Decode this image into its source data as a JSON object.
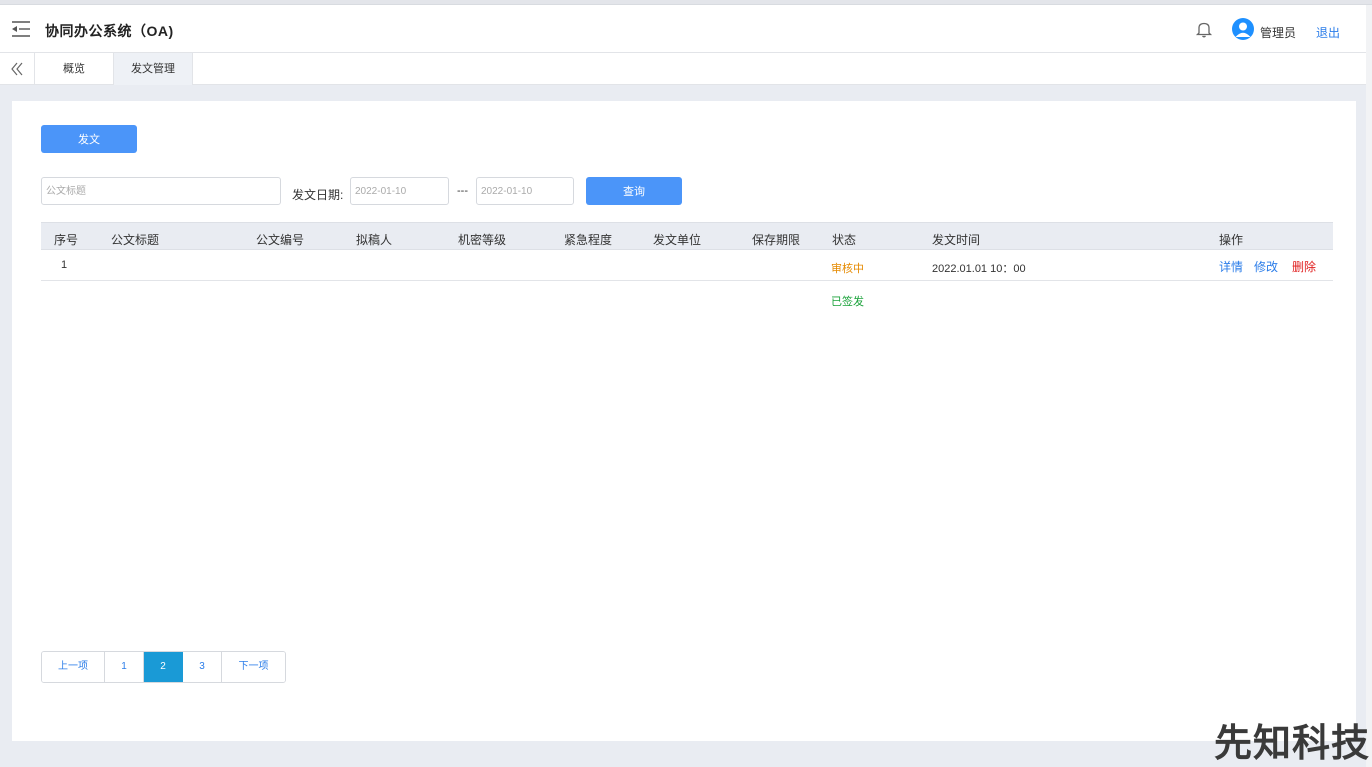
{
  "header": {
    "title": "协同办公系统（OA)",
    "user_name": "管理员",
    "logout_label": "退出"
  },
  "tabs": [
    {
      "label": "概览",
      "active": false
    },
    {
      "label": "发文管理",
      "active": true
    }
  ],
  "toolbar": {
    "send_label": "发文"
  },
  "search": {
    "title_placeholder": "公文标题",
    "date_label": "发文日期:",
    "date_from": "2022-01-10",
    "date_separator": "---",
    "date_to": "2022-01-10",
    "query_label": "查询"
  },
  "table": {
    "columns": [
      "序号",
      "公文标题",
      "公文编号",
      "拟稿人",
      "机密等级",
      "紧急程度",
      "发文单位",
      "保存期限",
      "状态",
      "发文时间",
      "操作"
    ],
    "rows": [
      {
        "index": "1",
        "status": "审核中",
        "time": "2022.01.01  10：00",
        "actions": {
          "detail": "详情",
          "edit": "修改",
          "delete": "删除"
        }
      },
      {
        "status": "已签发"
      }
    ]
  },
  "pagination": {
    "prev": "上一项",
    "pages": [
      "1",
      "2",
      "3"
    ],
    "current": "2",
    "next": "下一项"
  },
  "watermark": "先知科技",
  "colors": {
    "primary": "#4b95f9",
    "link": "#2b7de9",
    "danger": "#e02020",
    "warning": "#e58a00",
    "success": "#1aa23a",
    "page_active": "#1a9ad6"
  }
}
